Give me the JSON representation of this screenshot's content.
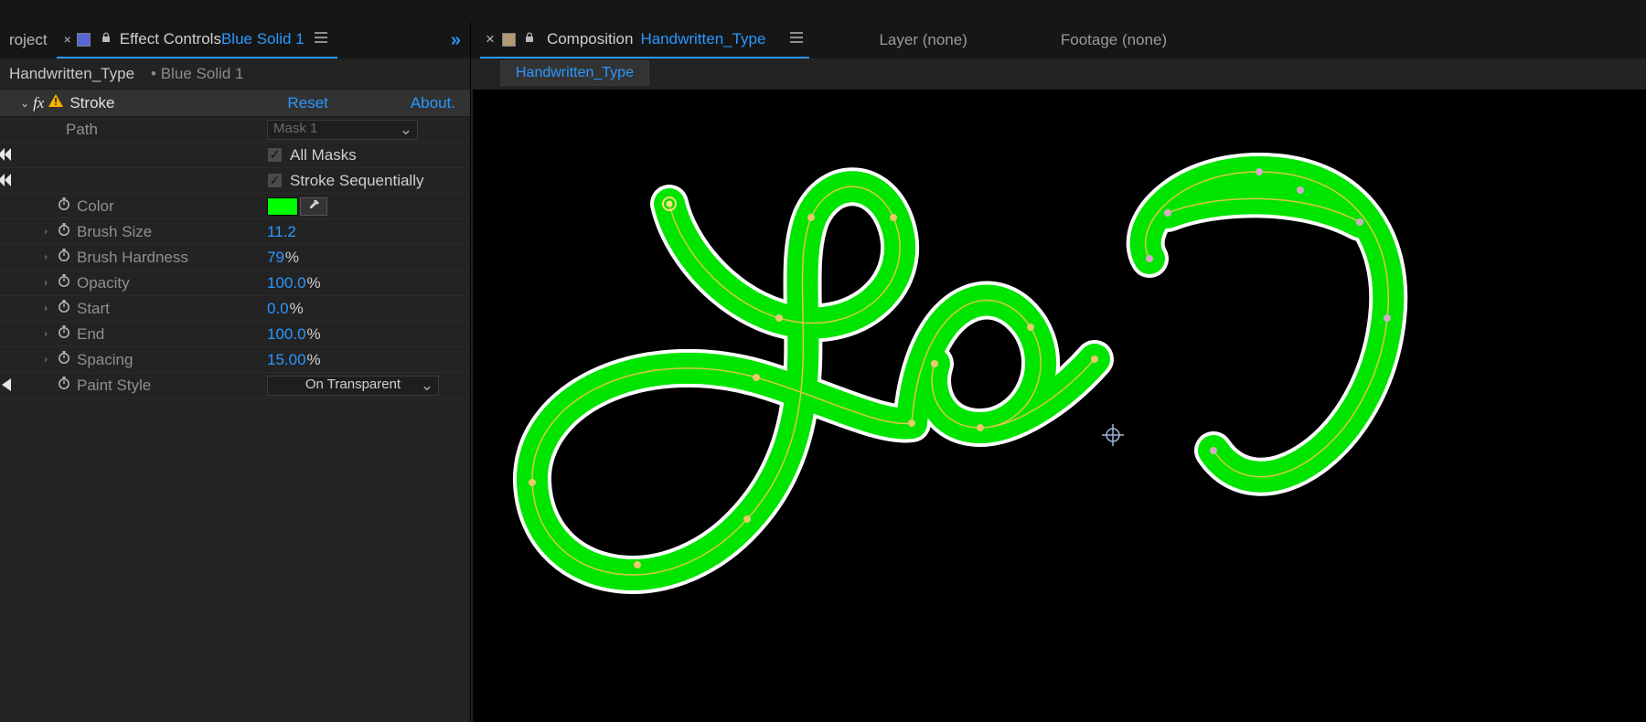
{
  "left_panel": {
    "tabs": {
      "project_label": "roject",
      "effect_controls_prefix": "Effect Controls ",
      "effect_controls_layer": "Blue Solid 1"
    },
    "breadcrumb": {
      "comp_name": "Handwritten_Type",
      "layer_name": "Blue Solid 1"
    },
    "effect": {
      "name": "Stroke",
      "reset_label": "Reset",
      "about_label": "About.",
      "props": {
        "path_label": "Path",
        "path_value": "Mask 1",
        "all_masks_label": "All Masks",
        "stroke_seq_label": "Stroke Sequentially",
        "all_masks_checked": true,
        "stroke_seq_checked": true,
        "color_label": "Color",
        "color_value": "#00ff00",
        "brush_size_label": "Brush Size",
        "brush_size_value": "11.2",
        "brush_hardness_label": "Brush Hardness",
        "brush_hardness_value": "79",
        "opacity_label": "Opacity",
        "opacity_value": "100.0",
        "start_label": "Start",
        "start_value": "0.0",
        "end_label": "End",
        "end_value": "100.0",
        "spacing_label": "Spacing",
        "spacing_value": "15.00",
        "paint_style_label": "Paint Style",
        "paint_style_value": "On Transparent",
        "percent_unit": "%"
      }
    }
  },
  "right_panel": {
    "tabs": {
      "composition_prefix": "Composition ",
      "composition_name": "Handwritten_Type",
      "layer_label": "Layer (none)",
      "footage_label": "Footage (none)"
    },
    "breadcrumb_chip": "Handwritten_Type"
  },
  "colors": {
    "accent_blue": "#2a97ff",
    "stroke_green": "#00ff00",
    "layer_swatch": "#5a66d8",
    "comp_swatch": "#b29a74"
  }
}
